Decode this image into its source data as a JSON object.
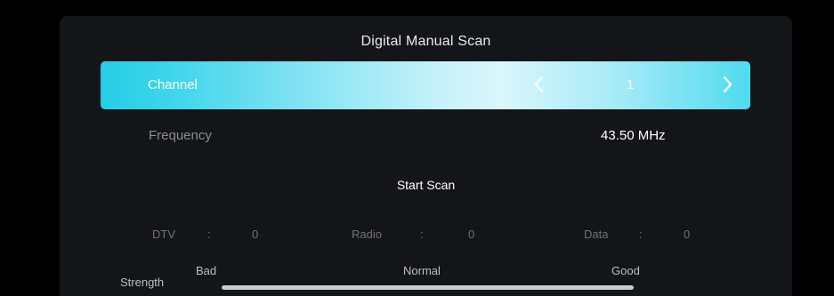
{
  "screen": {
    "title": "Digital Manual Scan"
  },
  "channel": {
    "label": "Channel",
    "value": "1",
    "prev_icon": "chevron-left-icon",
    "next_icon": "chevron-right-icon"
  },
  "frequency": {
    "label": "Frequency",
    "value": "43.50 MHz"
  },
  "start_scan_label": "Start Scan",
  "results": {
    "separator": ":",
    "dtv": {
      "label": "DTV",
      "count": "0"
    },
    "radio": {
      "label": "Radio",
      "count": "0"
    },
    "data": {
      "label": "Data",
      "count": "0"
    }
  },
  "strength": {
    "label": "Strength",
    "levels": [
      "Bad",
      "Normal",
      "Good"
    ],
    "level_fraction": 1.0
  },
  "colors": {
    "accent": "#27cde6",
    "panel": "#141519",
    "background": "#000000"
  }
}
